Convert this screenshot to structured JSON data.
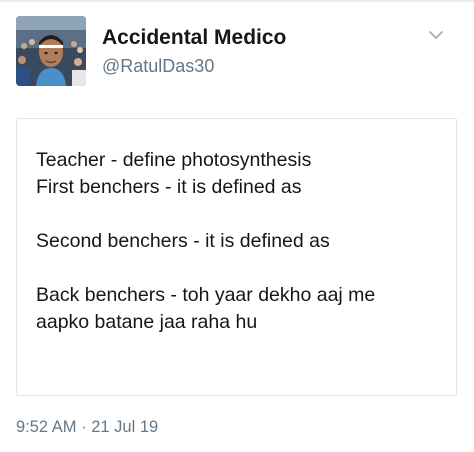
{
  "tweet": {
    "author": {
      "display_name": "Accidental Medico",
      "handle": "@RatulDas30",
      "avatar_icon": "profile-photo-selfie-stadium"
    },
    "menu_icon": "chevron-down-icon",
    "text_lines": [
      "Teacher - define photosynthesis",
      "First benchers - it is defined as",
      "",
      "Second benchers - it is defined as",
      "",
      "Back benchers - toh yaar dekho aaj me",
      "aapko batane jaa raha hu"
    ],
    "time": "9:52 AM",
    "separator": "·",
    "date": "21 Jul 19"
  },
  "colors": {
    "text_primary": "#14171a",
    "text_secondary": "#657786",
    "border": "#e1e8ed",
    "chevron": "#aab8c2"
  }
}
